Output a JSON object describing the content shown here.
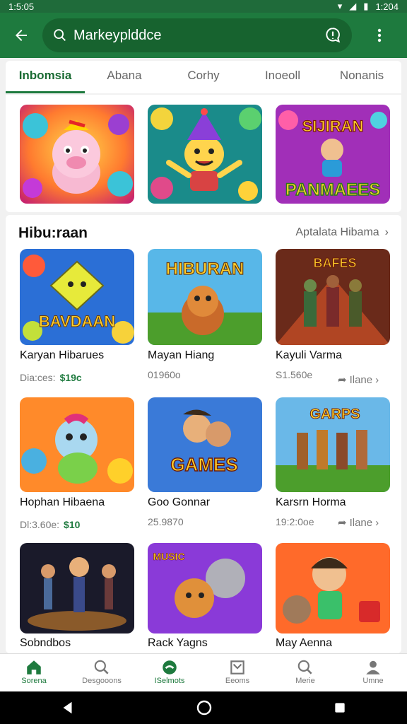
{
  "status": {
    "time": "1:5:05",
    "battery": "1:204"
  },
  "search": {
    "value": "Markeyplddce"
  },
  "tabs": [
    "Inbomsia",
    "Abana",
    "Corhy",
    "Inoeoll",
    "Nonanis"
  ],
  "featured": [
    {
      "image": "cartoon-pig-character",
      "text": ""
    },
    {
      "image": "party-hat-character",
      "text": ""
    },
    {
      "image": "family-banner",
      "text_top": "SIJIRAN",
      "text_bottom": "PANMAEES"
    }
  ],
  "section": {
    "title": "Hibu:raan",
    "link_label": "Aptalata Hibama"
  },
  "games": [
    {
      "title": "Karyan Hibarues",
      "sub": "Dia:ces:",
      "price": "$19c",
      "image_text": "BAVDAAN"
    },
    {
      "title": "Mayan Hiang",
      "sub": "01960o",
      "image_text": "HIBURAN"
    },
    {
      "title": "Kayuli Varma",
      "sub": "S1.560e",
      "more": "Ilane",
      "image_text": "BAFES"
    },
    {
      "title": "Hophan Hibaena",
      "sub": "Dl:3.60e:",
      "price": "$10",
      "image_text": ""
    },
    {
      "title": "Goo Gonnar",
      "sub": "25.9870",
      "image_text": "GAMES"
    },
    {
      "title": "Karsrn Horma",
      "sub": "19:2:0oe",
      "more": "Ilane",
      "image_text": "GARPS"
    },
    {
      "title": "Sobndbos",
      "sub": "",
      "image_text": ""
    },
    {
      "title": "Rack Yagns",
      "sub": "",
      "image_text": "MUSIC"
    },
    {
      "title": "May Aenna",
      "sub": "",
      "image_text": ""
    }
  ],
  "bottom_nav": [
    {
      "label": "Sorena",
      "icon": "home-icon"
    },
    {
      "label": "Desgooons",
      "icon": "search-icon"
    },
    {
      "label": "ISelmots",
      "icon": "games-icon"
    },
    {
      "label": "Eeoms",
      "icon": "bookmark-icon"
    },
    {
      "label": "Merie",
      "icon": "search-icon"
    },
    {
      "label": "Umne",
      "icon": "person-icon"
    }
  ],
  "colors": {
    "primary": "#1e7a3e",
    "primary_dark": "#17632f",
    "accent_price": "#1e7a3e"
  }
}
